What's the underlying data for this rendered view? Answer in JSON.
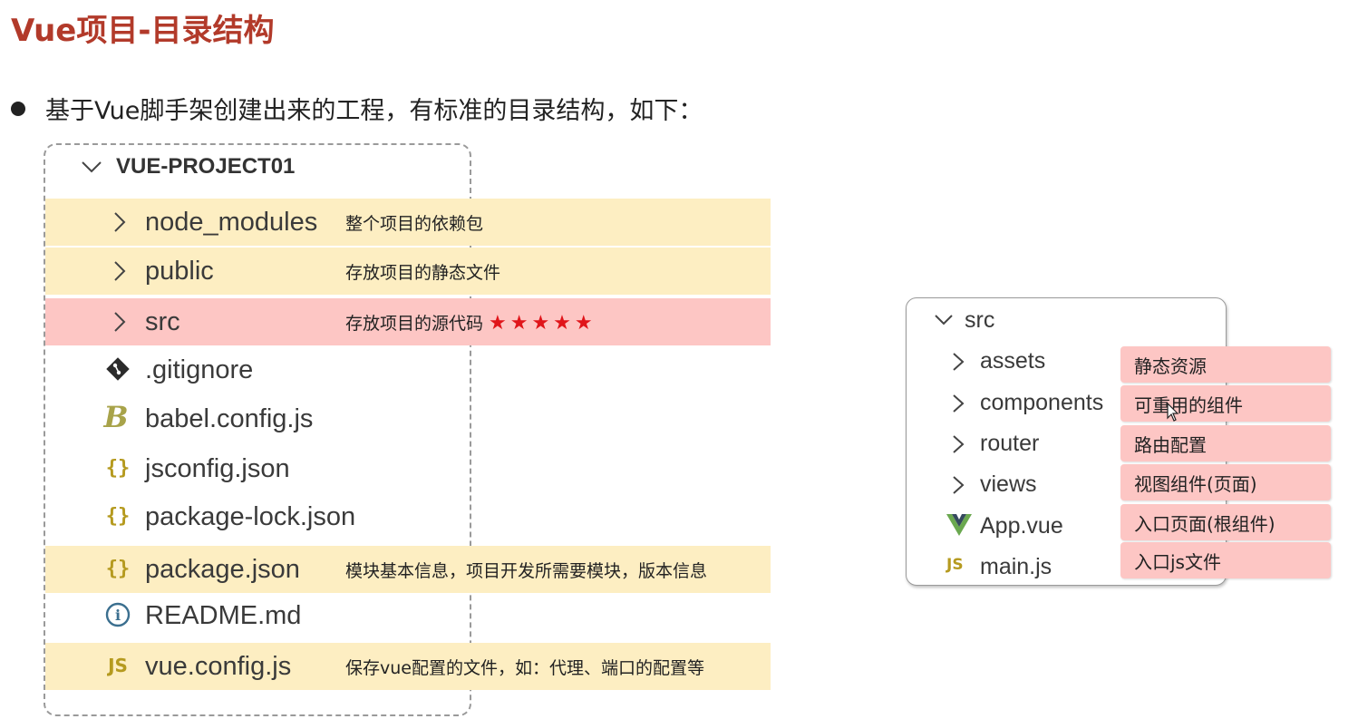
{
  "title": "Vue项目-目录结构",
  "intro": "基于Vue脚手架创建出来的工程，有标准的目录结构，如下：",
  "project_tree": {
    "root": "VUE-PROJECT01",
    "items": [
      {
        "label": "node_modules",
        "type": "folder",
        "note": "整个项目的依赖包",
        "highlight": "yellow"
      },
      {
        "label": "public",
        "type": "folder",
        "note": "存放项目的静态文件",
        "highlight": "yellow"
      },
      {
        "label": "src",
        "type": "folder",
        "note": "存放项目的源代码",
        "stars": "★★★★★",
        "highlight": "red"
      },
      {
        "label": ".gitignore",
        "type": "file",
        "icon": "git-icon"
      },
      {
        "label": "babel.config.js",
        "type": "file",
        "icon": "babel-icon",
        "icon_text": "B"
      },
      {
        "label": "jsconfig.json",
        "type": "file",
        "icon": "json-icon",
        "icon_text": "{}"
      },
      {
        "label": "package-lock.json",
        "type": "file",
        "icon": "json-icon",
        "icon_text": "{}"
      },
      {
        "label": "package.json",
        "type": "file",
        "icon": "json-icon",
        "icon_text": "{}",
        "note": "模块基本信息，项目开发所需要模块，版本信息",
        "highlight": "yellow"
      },
      {
        "label": "README.md",
        "type": "file",
        "icon": "info-icon",
        "icon_text": "i"
      },
      {
        "label": "vue.config.js",
        "type": "file",
        "icon": "js-icon",
        "icon_text": "JS",
        "note": "保存vue配置的文件，如：代理、端口的配置等",
        "highlight": "yellow"
      }
    ]
  },
  "src_tree": {
    "root": "src",
    "items": [
      {
        "label": "assets",
        "type": "folder",
        "note": "静态资源"
      },
      {
        "label": "components",
        "type": "folder",
        "note": "可重用的组件"
      },
      {
        "label": "router",
        "type": "folder",
        "note": "路由配置"
      },
      {
        "label": "views",
        "type": "folder",
        "note": "视图组件(页面)"
      },
      {
        "label": "App.vue",
        "type": "file",
        "icon": "vue-icon",
        "note": "入口页面(根组件)"
      },
      {
        "label": "main.js",
        "type": "file",
        "icon": "js-icon",
        "icon_text": "JS",
        "note": "入口js文件"
      }
    ]
  },
  "colors": {
    "title": "#b23a2a",
    "highlight_yellow": "#fdeec2",
    "highlight_red": "#fdc6c4",
    "star": "#e0151a",
    "icon_gold": "#b59a1f"
  }
}
